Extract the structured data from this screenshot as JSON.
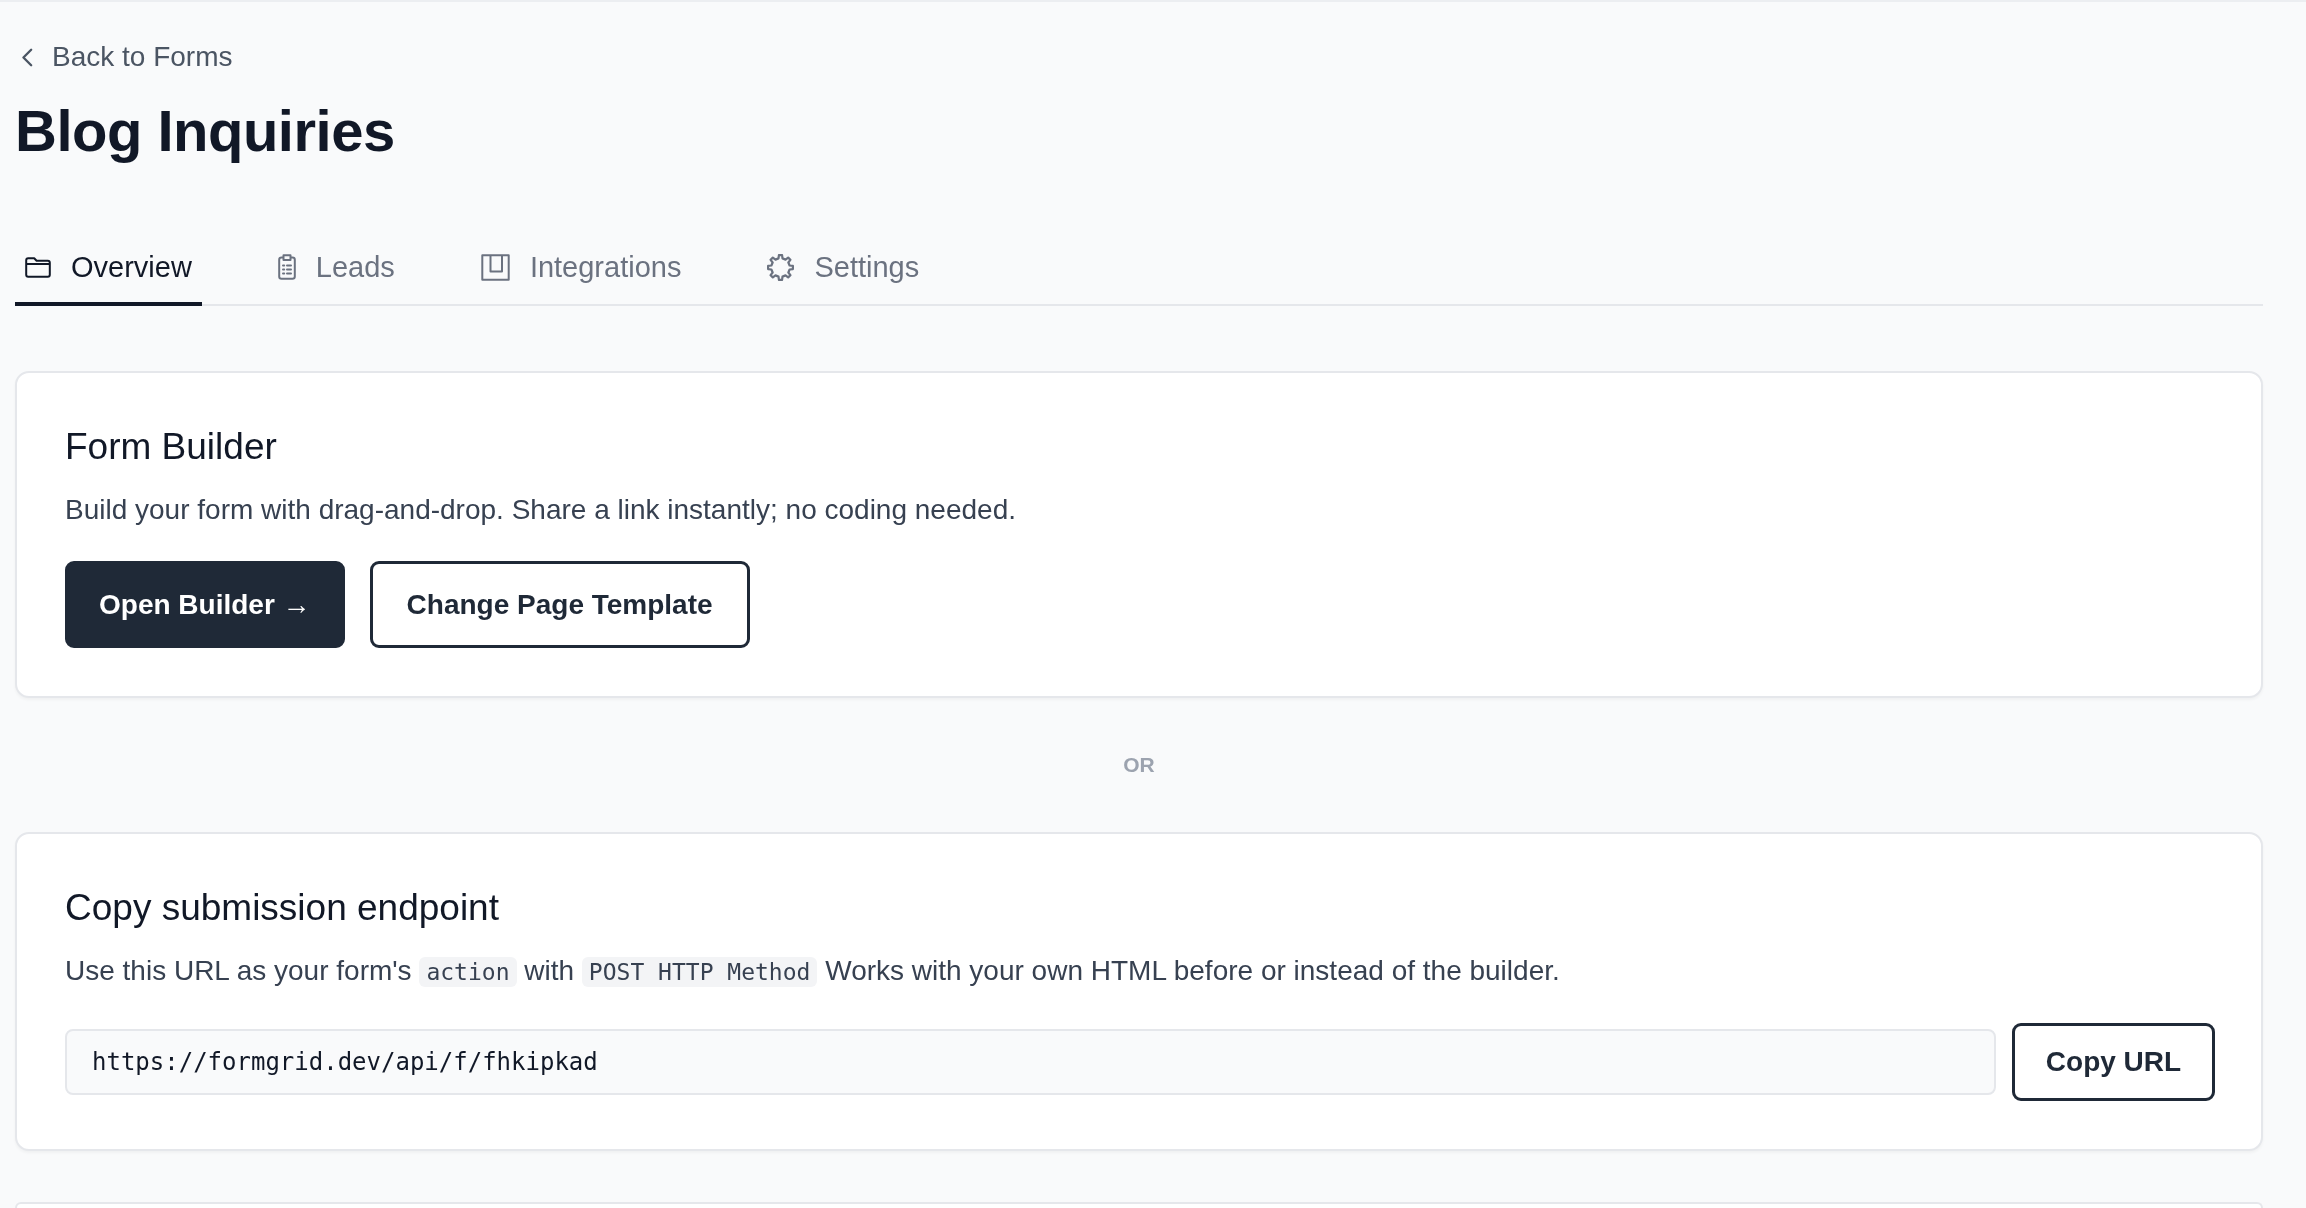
{
  "back_link": {
    "label": "Back to Forms"
  },
  "title": "Blog Inquiries",
  "tabs": [
    {
      "label": "Overview",
      "selected": true
    },
    {
      "label": "Leads",
      "selected": false
    },
    {
      "label": "Integrations",
      "selected": false
    },
    {
      "label": "Settings",
      "selected": false
    }
  ],
  "form_builder": {
    "title": "Form Builder",
    "description": "Build your form with drag-and-drop. Share a link instantly; no coding needed.",
    "buttons": [
      {
        "label": "Open Builder →",
        "kind": "primary"
      },
      {
        "label": "Change Page Template",
        "kind": "secondary"
      }
    ]
  },
  "separator_label": "OR",
  "endpoint": {
    "title": "Copy submission endpoint",
    "description": [
      {
        "kind": "text",
        "text": "Use this URL as your form's"
      },
      {
        "kind": "code",
        "text": "action"
      },
      {
        "kind": "text",
        "text": "with"
      },
      {
        "kind": "code",
        "text": "POST HTTP Method"
      },
      {
        "kind": "text",
        "text": "Works with your own HTML before or instead of the builder."
      }
    ],
    "url_field": {
      "value": "https://formgrid.dev/api/f/fhkipkad"
    },
    "copy_button": {
      "label": "Copy URL"
    }
  }
}
